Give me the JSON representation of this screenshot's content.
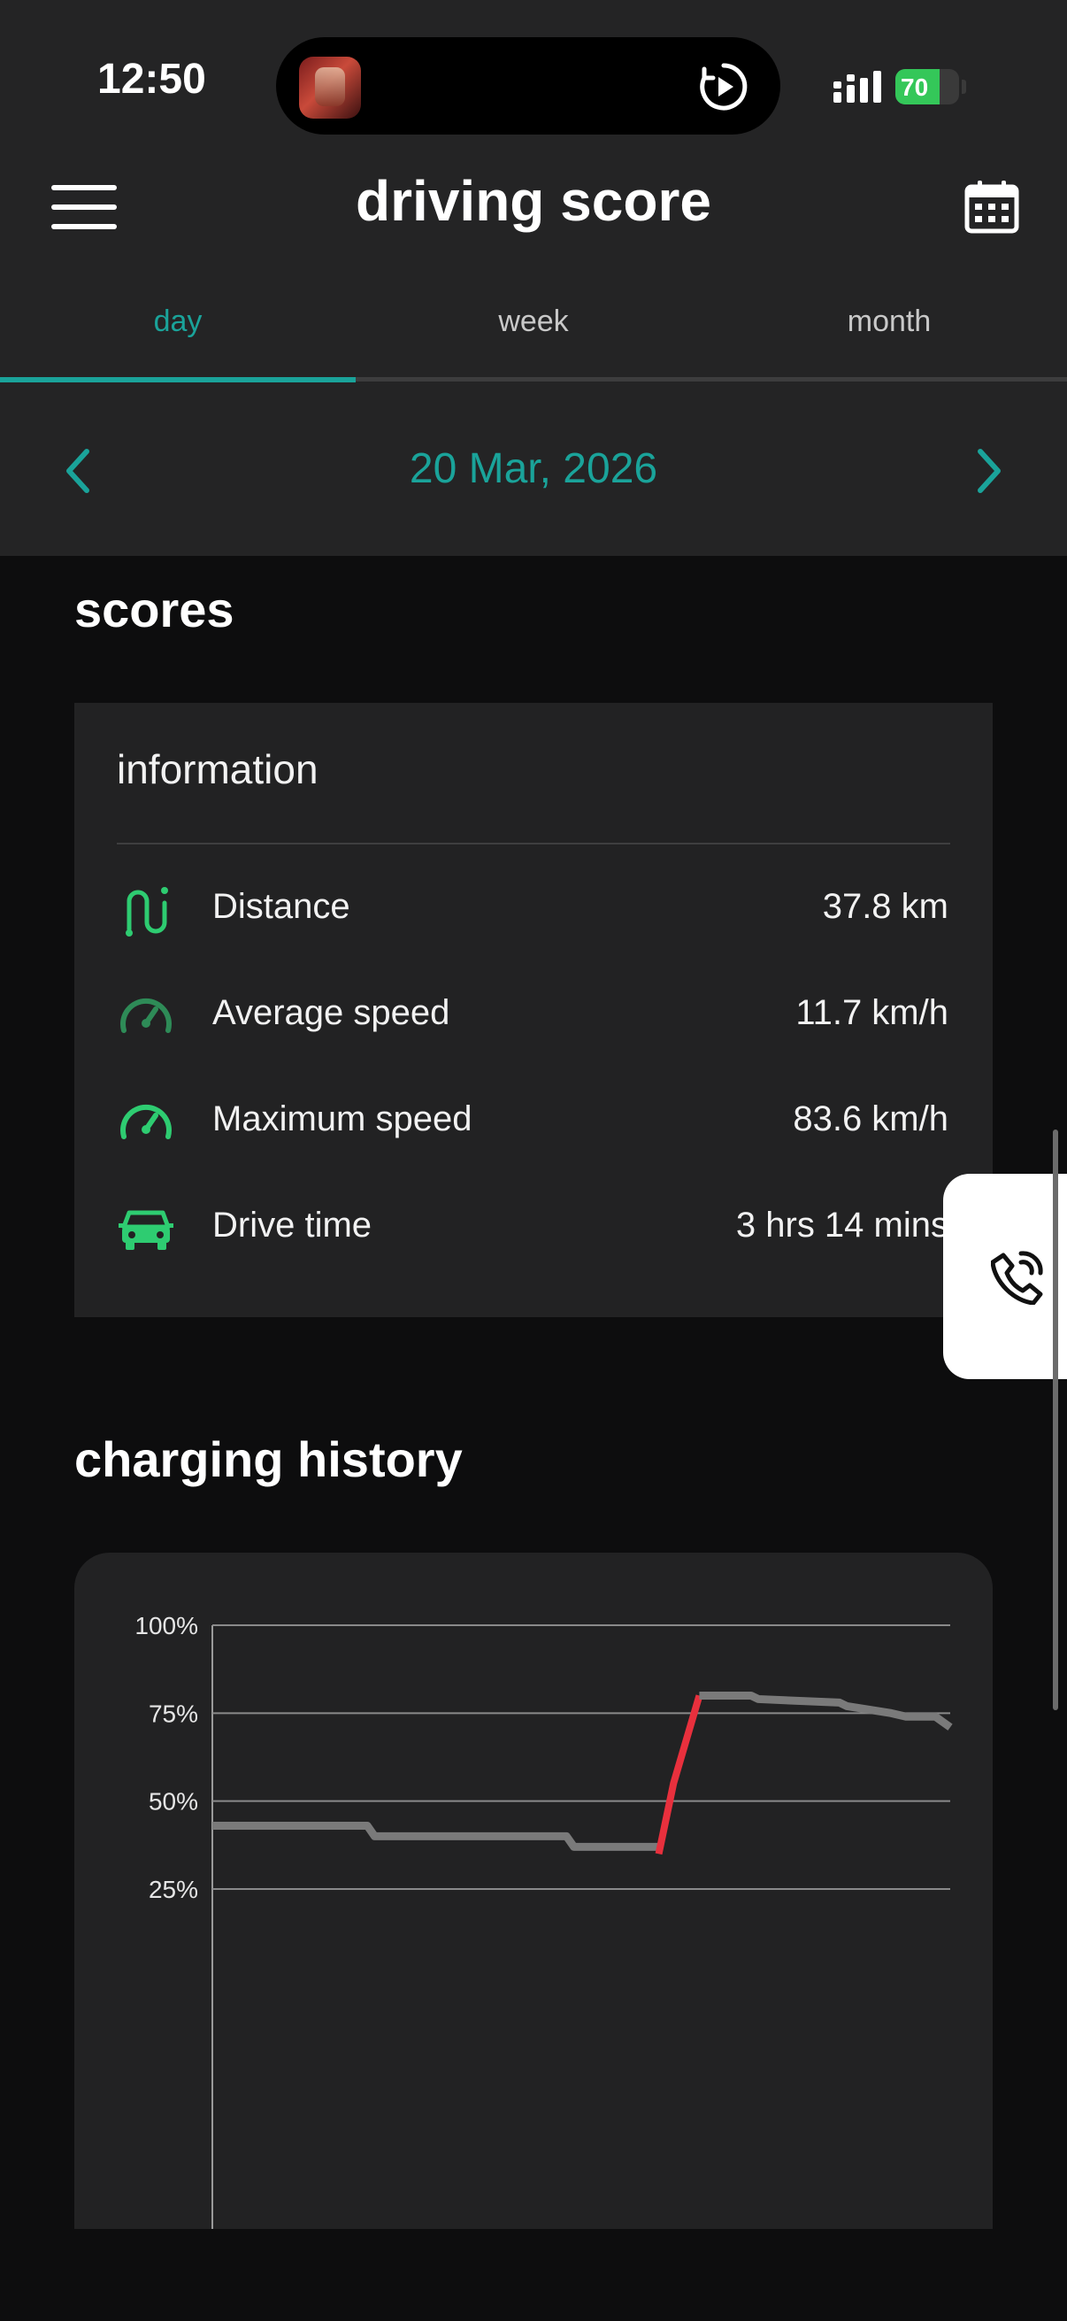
{
  "status_bar": {
    "time": "12:50",
    "battery": "70",
    "battery_level": 0.7,
    "icons": [
      "game-app-icon",
      "play-circle-icon",
      "cellular-signal-icon",
      "battery-charging-icon"
    ]
  },
  "header": {
    "title": "driving score",
    "menu_icon": "hamburger-menu-icon",
    "calendar_icon": "calendar-icon"
  },
  "tabs": [
    {
      "label": "day",
      "active": true
    },
    {
      "label": "week",
      "active": false
    },
    {
      "label": "month",
      "active": false
    }
  ],
  "date_nav": {
    "date": "20 Mar, 2026",
    "prev_icon": "chevron-left-icon",
    "next_icon": "chevron-right-icon"
  },
  "scores": {
    "title": "scores",
    "card_title": "information",
    "rows": [
      {
        "label": "Distance",
        "value": "37.8 km",
        "icon": "route-icon"
      },
      {
        "label": "Average speed",
        "value": "11.7 km/h",
        "icon": "gauge-low-icon"
      },
      {
        "label": "Maximum speed",
        "value": "83.6 km/h",
        "icon": "gauge-high-icon"
      },
      {
        "label": "Drive time",
        "value": "3 hrs 14 mins",
        "icon": "car-icon"
      }
    ]
  },
  "floating_button": {
    "icon": "phone-call-icon"
  },
  "charging": {
    "title": "charging history"
  },
  "colors": {
    "accent": "#1aa39a",
    "icon_green": "#2ecc71",
    "charging_line": "#e8303d",
    "discharge_line": "#7a7a7a"
  },
  "chart_data": {
    "type": "line",
    "title": "",
    "xlabel": "",
    "ylabel": "",
    "ylim": [
      0,
      100
    ],
    "yticks": [
      "100%",
      "75%",
      "50%",
      "25%"
    ],
    "ytick_values": [
      100,
      75,
      50,
      25
    ],
    "grid": true,
    "series": [
      {
        "status": "discharging",
        "x": [
          0,
          21,
          22,
          48,
          49,
          60.5
        ],
        "y": [
          43,
          43,
          40,
          40,
          37,
          37
        ]
      },
      {
        "status": "charging",
        "x": [
          60.5,
          62.5,
          66
        ],
        "y": [
          35,
          55,
          80
        ]
      },
      {
        "status": "discharging",
        "x": [
          66,
          73,
          74,
          85,
          86,
          92,
          94,
          98,
          100
        ],
        "y": [
          80,
          80,
          79,
          78,
          77,
          75,
          74,
          74,
          71
        ]
      }
    ]
  }
}
